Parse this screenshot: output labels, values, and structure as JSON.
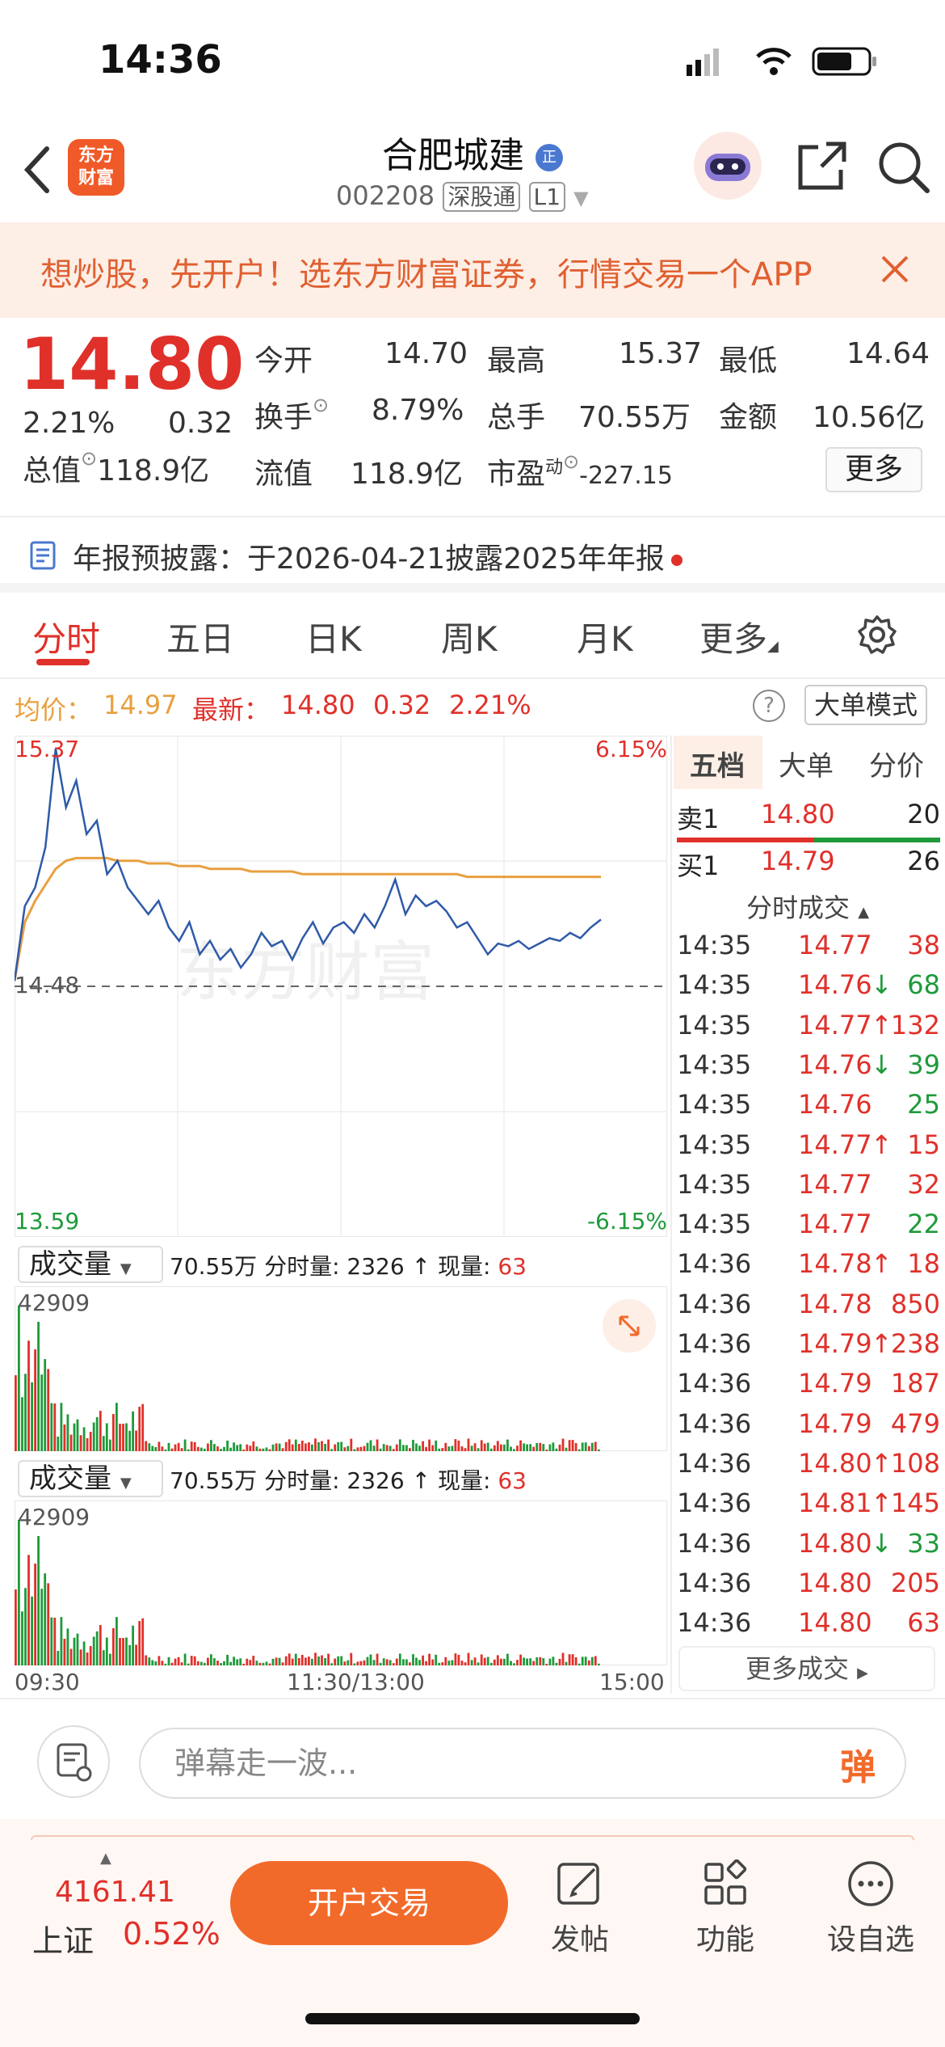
{
  "status_bar": {
    "time": "14:36"
  },
  "header": {
    "logo_text_1": "东方",
    "logo_text_2": "财富",
    "stock_name": "合肥城建",
    "stock_code": "002208",
    "market_badge": "深股通",
    "level_badge": "L1",
    "name_badge": "正"
  },
  "banner": {
    "text": "想炒股，先开户！选东方财富证券，行情交易一个APP"
  },
  "quote": {
    "price": "14.80",
    "change_pct": "2.21%",
    "change": "0.32",
    "open_label": "今开",
    "open": "14.70",
    "high_label": "最高",
    "high": "15.37",
    "low_label": "最低",
    "low": "14.64",
    "turnover_label": "换手",
    "turnover": "8.79%",
    "volume_label": "总手",
    "volume": "70.55万",
    "amount_label": "金额",
    "amount": "10.56亿",
    "mktcap_label": "总值",
    "mktcap": "118.9亿",
    "float_label": "流值",
    "float_cap": "118.9亿",
    "pe_label": "市盈",
    "pe_sup": "动",
    "pe": "-227.15",
    "more_label": "更多"
  },
  "notice": {
    "text": "年报预披露：于2026-04-21披露2025年年报"
  },
  "tabs": [
    "分时",
    "五日",
    "日K",
    "周K",
    "月K",
    "更多"
  ],
  "info_line": {
    "avg_label": "均价：",
    "avg": "14.97",
    "last_label": "最新：",
    "last": "14.80",
    "chg": "0.32",
    "pct": "2.21%",
    "big_order_mode": "大单模式"
  },
  "chart_data": {
    "type": "line",
    "title": "",
    "y_max_label": "15.37",
    "y_min_label": "13.59",
    "y_ref_label": "14.48",
    "pct_max_label": "6.15%",
    "pct_min_label": "-6.15%",
    "x_ticks": [
      "09:30",
      "11:30/13:00",
      "15:00"
    ],
    "ylim": [
      13.59,
      15.37
    ],
    "reference": 14.48,
    "watermark": "东方财富",
    "series": [
      {
        "values": [
          14.5,
          14.78,
          14.85,
          15.0,
          15.37,
          15.15,
          15.25,
          15.05,
          15.1,
          14.9,
          14.95,
          14.85,
          14.8,
          14.75,
          14.8,
          14.7,
          14.65,
          14.72,
          14.6,
          14.65,
          14.58,
          14.62,
          14.55,
          14.6,
          14.68,
          14.63,
          14.65,
          14.58,
          14.66,
          14.72,
          14.64,
          14.7,
          14.72,
          14.68,
          14.75,
          14.7,
          14.78,
          14.88,
          14.75,
          14.82,
          14.78,
          14.8,
          14.76,
          14.7,
          14.72,
          14.66,
          14.6,
          14.64,
          14.63,
          14.65,
          14.62,
          14.64,
          14.66,
          14.65,
          14.68,
          14.66,
          14.7,
          14.73
        ]
      },
      {
        "values": [
          14.5,
          14.72,
          14.8,
          14.86,
          14.92,
          14.95,
          14.96,
          14.96,
          14.96,
          14.96,
          14.95,
          14.95,
          14.95,
          14.94,
          14.94,
          14.94,
          14.93,
          14.93,
          14.93,
          14.92,
          14.92,
          14.92,
          14.92,
          14.91,
          14.91,
          14.91,
          14.91,
          14.91,
          14.9,
          14.9,
          14.9,
          14.9,
          14.9,
          14.9,
          14.9,
          14.9,
          14.9,
          14.9,
          14.9,
          14.9,
          14.9,
          14.9,
          14.9,
          14.9,
          14.89,
          14.89,
          14.89,
          14.89,
          14.89,
          14.89,
          14.89,
          14.89,
          14.89,
          14.89,
          14.89,
          14.89,
          14.89,
          14.89
        ]
      }
    ]
  },
  "volume_panels": [
    {
      "select": "成交量",
      "total": "70.55万",
      "fs_label": "分时量:",
      "fs_value": "2326",
      "arrow": "↑",
      "now_label": "现量:",
      "now_value": "63",
      "max_label": "42909"
    },
    {
      "select": "成交量",
      "total": "70.55万",
      "fs_label": "分时量:",
      "fs_value": "2326",
      "arrow": "↑",
      "now_label": "现量:",
      "now_value": "63",
      "max_label": "42909"
    }
  ],
  "panel": {
    "tabs": [
      "五档",
      "大单",
      "分价"
    ],
    "sell_label": "卖1",
    "sell_price": "14.80",
    "sell_qty": "20",
    "buy_label": "买1",
    "buy_price": "14.79",
    "buy_qty": "26",
    "trades_title": "分时成交",
    "trades": [
      {
        "time": "14:35",
        "price": "14.77",
        "dir": "",
        "qty": "38",
        "qty_color": "red"
      },
      {
        "time": "14:35",
        "price": "14.76",
        "dir": "↓",
        "qty": "68",
        "qty_color": "green"
      },
      {
        "time": "14:35",
        "price": "14.77",
        "dir": "↑",
        "qty": "132",
        "qty_color": "red"
      },
      {
        "time": "14:35",
        "price": "14.76",
        "dir": "↓",
        "qty": "39",
        "qty_color": "green"
      },
      {
        "time": "14:35",
        "price": "14.76",
        "dir": "",
        "qty": "25",
        "qty_color": "green"
      },
      {
        "time": "14:35",
        "price": "14.77",
        "dir": "↑",
        "qty": "15",
        "qty_color": "red"
      },
      {
        "time": "14:35",
        "price": "14.77",
        "dir": "",
        "qty": "32",
        "qty_color": "red"
      },
      {
        "time": "14:35",
        "price": "14.77",
        "dir": "",
        "qty": "22",
        "qty_color": "green"
      },
      {
        "time": "14:36",
        "price": "14.78",
        "dir": "↑",
        "qty": "18",
        "qty_color": "red"
      },
      {
        "time": "14:36",
        "price": "14.78",
        "dir": "",
        "qty": "850",
        "qty_color": "red"
      },
      {
        "time": "14:36",
        "price": "14.79",
        "dir": "↑",
        "qty": "238",
        "qty_color": "red"
      },
      {
        "time": "14:36",
        "price": "14.79",
        "dir": "",
        "qty": "187",
        "qty_color": "red"
      },
      {
        "time": "14:36",
        "price": "14.79",
        "dir": "",
        "qty": "479",
        "qty_color": "red"
      },
      {
        "time": "14:36",
        "price": "14.80",
        "dir": "↑",
        "qty": "108",
        "qty_color": "red"
      },
      {
        "time": "14:36",
        "price": "14.81",
        "dir": "↑",
        "qty": "145",
        "qty_color": "red"
      },
      {
        "time": "14:36",
        "price": "14.80",
        "dir": "↓",
        "qty": "33",
        "qty_color": "green"
      },
      {
        "time": "14:36",
        "price": "14.80",
        "dir": "",
        "qty": "205",
        "qty_color": "red"
      },
      {
        "time": "14:36",
        "price": "14.80",
        "dir": "",
        "qty": "63",
        "qty_color": "red"
      }
    ],
    "more_trades": "更多成交"
  },
  "danmu": {
    "placeholder": "弹幕走一波...",
    "button": "弹"
  },
  "bottom": {
    "index_value": "4161.41",
    "index_name": "上证",
    "index_pct": "0.52%",
    "open_trade": "开户交易",
    "nav": [
      "发帖",
      "功能",
      "设自选"
    ]
  },
  "colors": {
    "up": "#e0302a",
    "down": "#1e9a3a",
    "avg_line": "#e8a040",
    "price_line": "#2e5aa8",
    "brand": "#f26a2a"
  }
}
